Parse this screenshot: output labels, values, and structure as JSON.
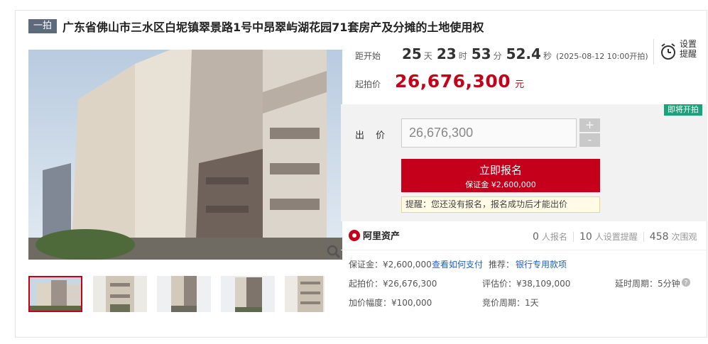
{
  "title": {
    "tag": "一拍",
    "text": "广东省佛山市三水区白坭镇翠景路1号中昂翠屿湖花园71套房产及分摊的土地使用权"
  },
  "countdown": {
    "label": "距开始",
    "days": "25",
    "days_unit": "天",
    "hours": "23",
    "hours_unit": "时",
    "minutes": "53",
    "minutes_unit": "分",
    "seconds": "52.4",
    "seconds_unit": "秒",
    "start_time": "(2025-08-12 10:00开拍)"
  },
  "reminder": {
    "line1": "设置",
    "line2": "提醒"
  },
  "start_price": {
    "label": "起拍价",
    "value": "26,676,300",
    "unit": "元"
  },
  "bid": {
    "status_badge": "即将开拍",
    "label": "出 价",
    "input_value": "26,676,300",
    "plus": "+",
    "minus": "-",
    "signup_label": "立即报名",
    "deposit_text": "保证金 ¥2,600,000",
    "hint": "提醒：您还没有报名，报名成功后才能出价"
  },
  "platform": {
    "name": "阿里资产"
  },
  "stats": {
    "signups": "0",
    "signups_label": "人报名",
    "reminders": "10",
    "reminders_label": "人设置提醒",
    "views": "458",
    "views_label": "次围观"
  },
  "details": {
    "deposit": "保证金：¥2,600,000",
    "how_to_pay": "查看如何支付",
    "recommend_label": "推荐：",
    "bank_loan": "银行专用款项",
    "start_price": "起拍价：¥26,676,300",
    "appraisal": "评估价：¥38,109,000",
    "delay": "延时周期：5分钟",
    "increment": "加价幅度：¥100,000",
    "auction_period": "竞价周期：1天"
  },
  "icons": {
    "zoom": "magnifier-icon",
    "alarm": "alarm-clock-icon",
    "help": "help-icon",
    "brand": "ali-logo-icon"
  },
  "colors": {
    "accent": "#c4001a",
    "status": "#1aa37a",
    "link": "#2160c4",
    "tag": "#5d6a7c"
  }
}
